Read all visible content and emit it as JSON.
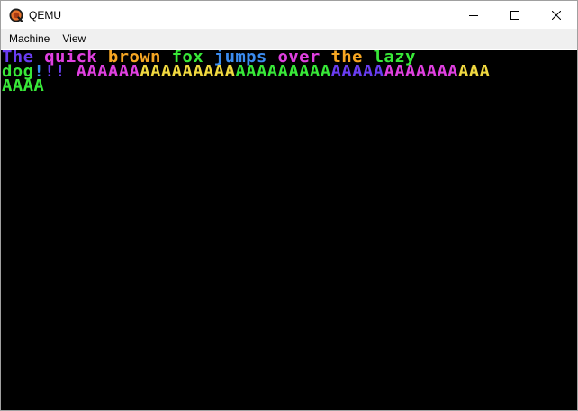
{
  "window": {
    "title": "QEMU",
    "icon": "qemu-logo-icon",
    "controls": {
      "minimize": "minimize-icon",
      "maximize": "maximize-icon",
      "close": "close-icon"
    }
  },
  "menubar": {
    "items": [
      {
        "label": "Machine"
      },
      {
        "label": "View"
      }
    ]
  },
  "screen": {
    "background": "#000000",
    "lines": [
      {
        "segments": [
          {
            "text": "The ",
            "color": "#6a3df2"
          },
          {
            "text": "quick ",
            "color": "#e040e0"
          },
          {
            "text": "brown ",
            "color": "#f6a623"
          },
          {
            "text": "fox ",
            "color": "#38e838"
          },
          {
            "text": "jumps ",
            "color": "#3b8cf0"
          },
          {
            "text": "over ",
            "color": "#e040e0"
          },
          {
            "text": "the ",
            "color": "#f6a623"
          },
          {
            "text": "lazy",
            "color": "#38e838"
          }
        ]
      },
      {
        "segments": [
          {
            "text": "dog",
            "color": "#38e838"
          },
          {
            "text": "!",
            "color": "#3b8cf0"
          },
          {
            "text": "!!",
            "color": "#6a3df2"
          },
          {
            "text": " ",
            "color": "#000000"
          },
          {
            "text": "AAAAAA",
            "color": "#e040e0"
          },
          {
            "text": "AAAAAAAAA",
            "color": "#f0d840"
          },
          {
            "text": "AAAAAAAAA",
            "color": "#38e838"
          },
          {
            "text": "AAAAA",
            "color": "#6a3df2"
          },
          {
            "text": "AAAAAAA",
            "color": "#e040e0"
          },
          {
            "text": "AAA",
            "color": "#f0d840"
          }
        ]
      },
      {
        "segments": [
          {
            "text": "AAAA",
            "color": "#38e838"
          }
        ]
      }
    ]
  }
}
